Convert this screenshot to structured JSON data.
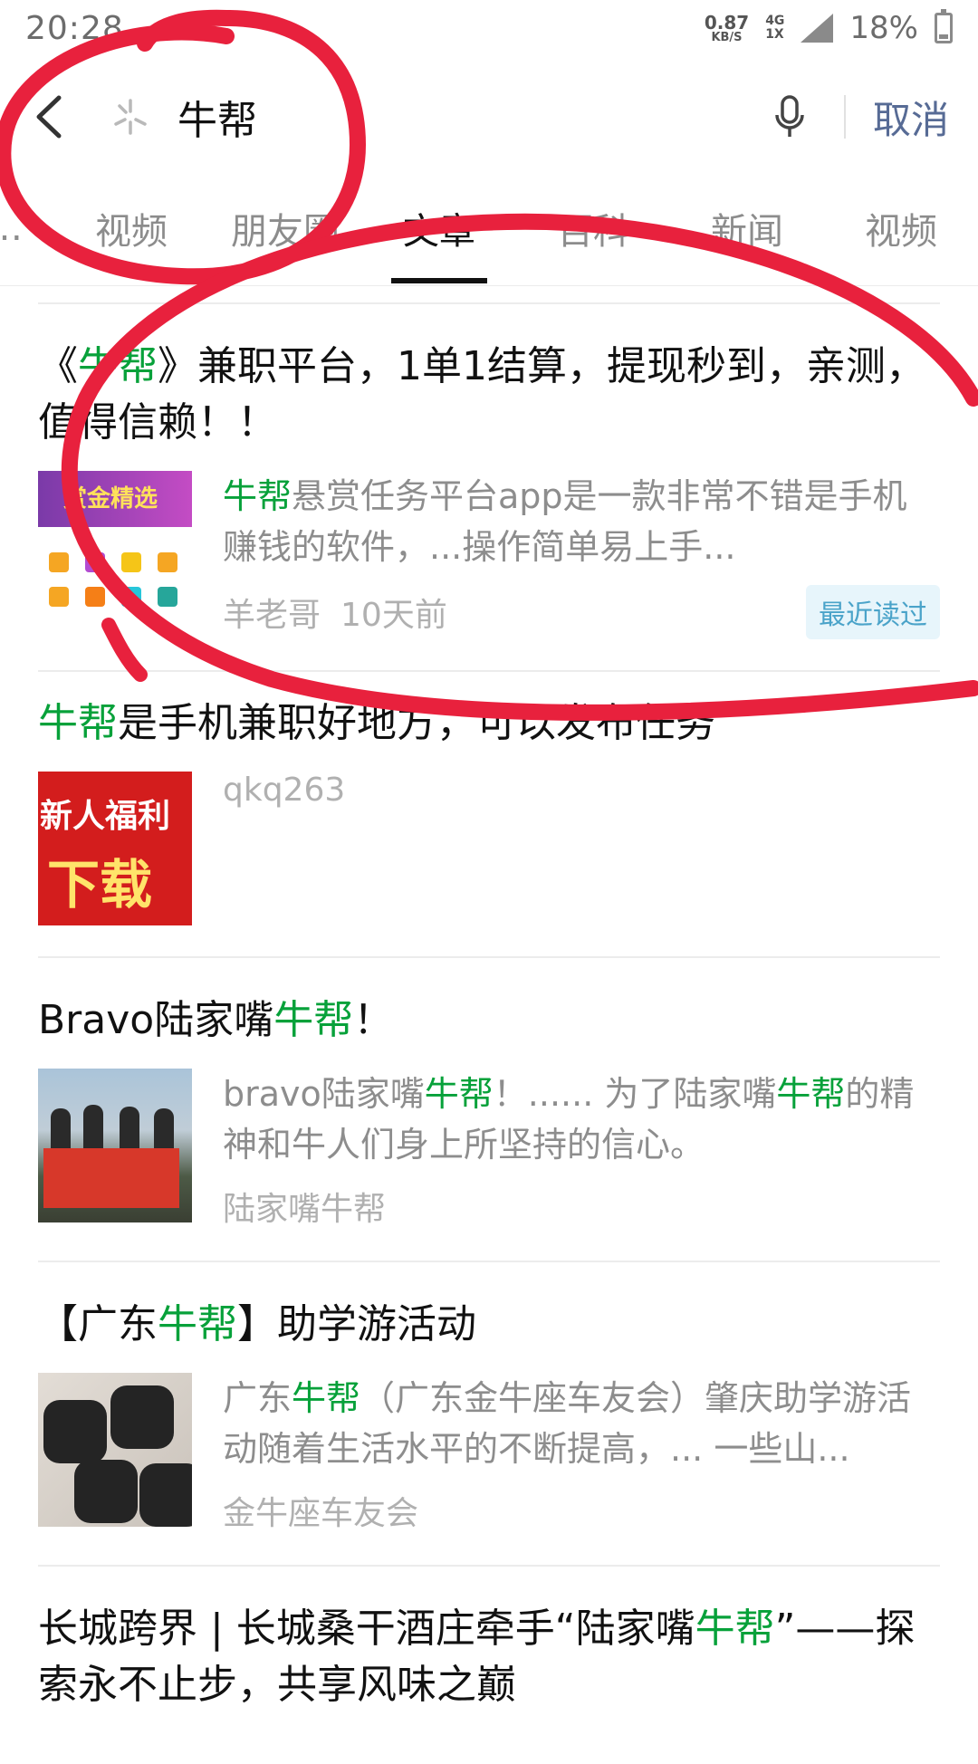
{
  "status_bar": {
    "time": "20:28",
    "net_speed_value": "0.87",
    "net_speed_unit": "KB/S",
    "net_type_top": "4G",
    "net_type_bottom": "1X",
    "battery": "18%"
  },
  "search": {
    "query": "牛帮",
    "cancel_label": "取消"
  },
  "tabs": [
    {
      "label": "…"
    },
    {
      "label": "视频"
    },
    {
      "label": "朋友圈"
    },
    {
      "label": "文章",
      "active": true
    },
    {
      "label": "百科"
    },
    {
      "label": "新闻"
    },
    {
      "label": "视频"
    }
  ],
  "results": [
    {
      "title_pre": "《",
      "title_hl": "牛帮",
      "title_post": "》兼职平台，1单1结算，提现秒到，亲测，值得信赖！！",
      "snippet_hl": "牛帮",
      "snippet_post": "悬赏任务平台app是一款非常不错是手机赚钱的软件，...操作简单易上手...",
      "author": "羊老哥",
      "time": "10天前",
      "badge": "最近读过",
      "thumb_text": "赏金精选"
    },
    {
      "title_pre": "",
      "title_hl": "牛帮",
      "title_post": "是手机兼职好地方，可以发布任务",
      "snippet_hl": "",
      "snippet_post": "",
      "author": "qkq263",
      "time": "",
      "badge": "",
      "thumb_text_1": "新人福利",
      "thumb_text_2": "下载"
    },
    {
      "title_pre": "Bravo陆家嘴",
      "title_hl": "牛帮",
      "title_post": "！",
      "snippet_pre": "bravo陆家嘴",
      "snippet_hl": "牛帮",
      "snippet_mid": "！...... 为了陆家嘴",
      "snippet_hl2": "牛帮",
      "snippet_post": "的精神和牛人们身上所坚持的信心。",
      "author": "陆家嘴牛帮",
      "time": "",
      "badge": ""
    },
    {
      "title_pre": "【广东",
      "title_hl": "牛帮",
      "title_post": "】助学游活动",
      "snippet_pre": "广东",
      "snippet_hl": "牛帮",
      "snippet_post": "（广东金牛座车友会）肇庆助学游活动随着生活水平的不断提高，... 一些山...",
      "author": "金牛座车友会",
      "time": "",
      "badge": ""
    },
    {
      "title_pre": "长城跨界 | 长城桑干酒庄牵手“陆家嘴",
      "title_hl": "牛帮",
      "title_post": "”——探索永不止步，共享风味之巅"
    }
  ],
  "colors": {
    "highlight": "#07a13a",
    "cancel": "#576b95",
    "annotation": "#e8213d"
  }
}
